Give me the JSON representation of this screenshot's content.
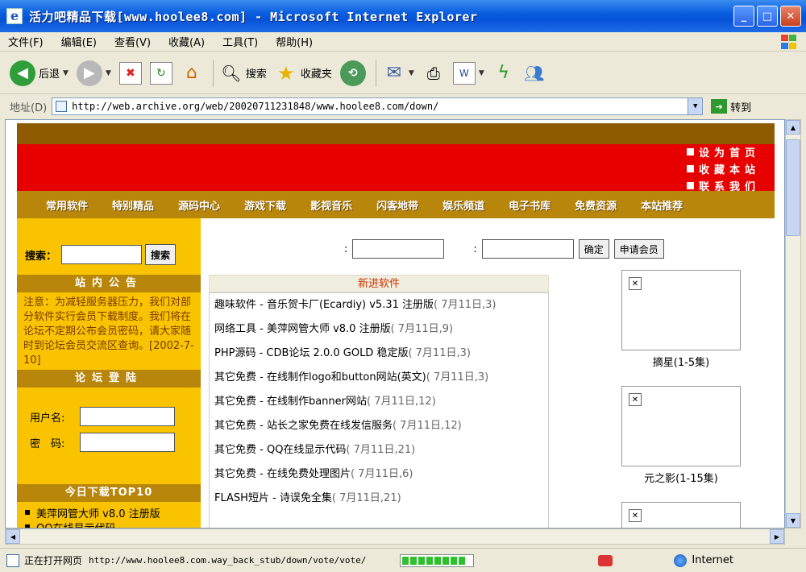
{
  "window": {
    "title": "活力吧精品下载[www.hoolee8.com] - Microsoft Internet Explorer"
  },
  "menu": [
    "文件(F)",
    "编辑(E)",
    "查看(V)",
    "收藏(A)",
    "工具(T)",
    "帮助(H)"
  ],
  "toolbar": {
    "back": "后退",
    "search": "搜索",
    "favorites": "收藏夹"
  },
  "address": {
    "label": "地址(D)",
    "url": "http://web.archive.org/web/20020711231848/www.hoolee8.com/down/",
    "go": "转到"
  },
  "site": {
    "banner_links": [
      "设为首页",
      "收藏本站",
      "联系我们"
    ],
    "nav": [
      "常用软件",
      "特别精品",
      "源码中心",
      "游戏下载",
      "影视音乐",
      "闪客地带",
      "娱乐频道",
      "电子书库",
      "免费资源",
      "本站推荐"
    ],
    "search_label": "搜索：",
    "search_btn": "搜索",
    "notice_head": "站内公告",
    "notice_text": "注意：为减轻服务器压力，我们对部分软件实行会员下载制度。我们将在论坛不定期公布会员密码，请大家随时到论坛会员交流区查询。[2002-7-10]",
    "forum_head": "论坛登陆",
    "username_label": "用户名:",
    "password_label": "密　码:",
    "login_colon1": ":",
    "login_colon2": ":",
    "confirm_btn": "确定",
    "apply_btn": "申请会员",
    "newsoft_head": "新进软件",
    "top10_head": "今日下载TOP10",
    "top10": [
      "美萍网管大师 v8.0 注册版",
      "QQ在线显示代码"
    ],
    "news": [
      {
        "title": "趣味软件 - 音乐贺卡厂(Ecardiy) v5.31 注册版",
        "meta": "( 7月11日,3)"
      },
      {
        "title": "网络工具 - 美萍网管大师 v8.0 注册版",
        "meta": "( 7月11日,9)"
      },
      {
        "title": "PHP源码 - CDB论坛 2.0.0 GOLD 稳定版",
        "meta": "( 7月11日,3)"
      },
      {
        "title": "其它免费 - 在线制作logo和button网站(英文)",
        "meta": "( 7月11日,3)"
      },
      {
        "title": "其它免费 - 在线制作banner网站",
        "meta": "( 7月11日,12)"
      },
      {
        "title": "其它免费 - 站长之家免费在线发信服务",
        "meta": "( 7月11日,12)"
      },
      {
        "title": "其它免费 - QQ在线显示代码",
        "meta": "( 7月11日,21)"
      },
      {
        "title": "其它免费 - 在线免费处理图片",
        "meta": "( 7月11日,6)"
      },
      {
        "title": "FLASH短片 - 诗误免全集",
        "meta": "( 7月11日,21)"
      }
    ],
    "thumbs": [
      "摘星(1-5集)",
      "元之影(1-15集)"
    ]
  },
  "status": {
    "text": "正在打开网页",
    "url": "http://www.hoolee8.com.way_back_stub/down/vote/vote/",
    "zone": "Internet"
  }
}
